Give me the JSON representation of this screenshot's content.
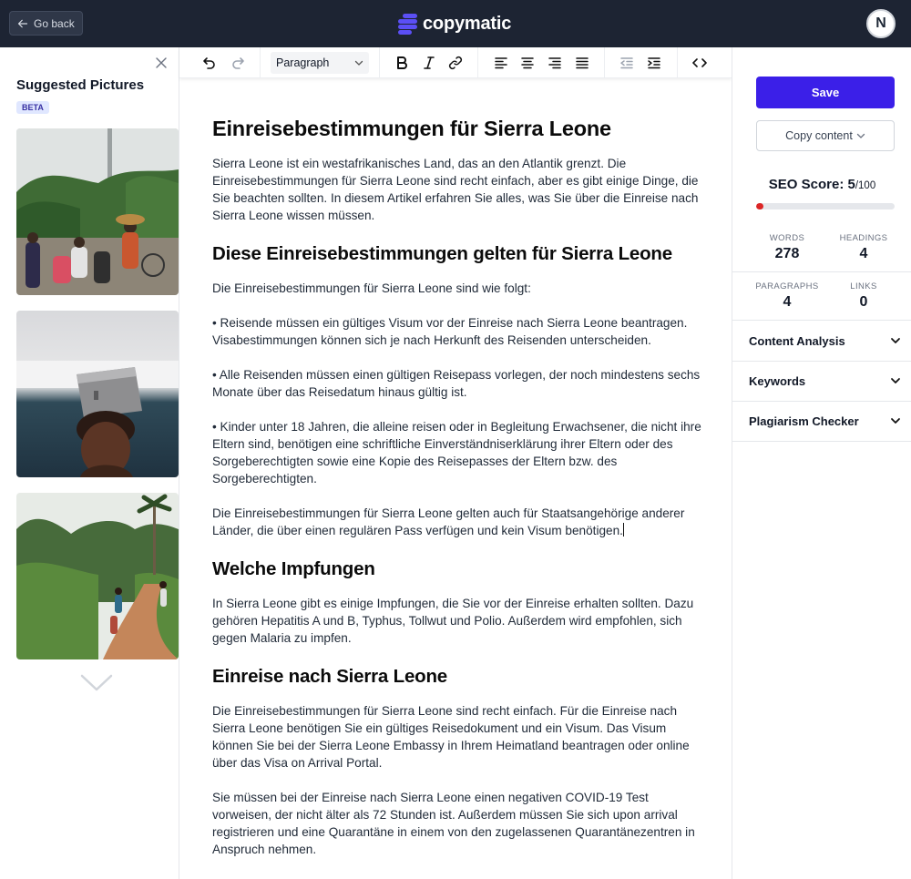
{
  "topbar": {
    "go_back_label": "Go back",
    "logo_text": "copymatic",
    "avatar_initial": "N"
  },
  "left_panel": {
    "title": "Suggested Pictures",
    "badge": "BETA",
    "pictures": [
      "street-market-photo",
      "box-on-head-photo",
      "dirt-road-photo"
    ]
  },
  "toolbar": {
    "block_format": "Paragraph",
    "icons": [
      "undo-icon",
      "redo-icon",
      "bold-icon",
      "italic-icon",
      "link-icon",
      "align-left-icon",
      "align-center-icon",
      "align-right-icon",
      "align-justify-icon",
      "outdent-icon",
      "indent-icon",
      "code-icon"
    ]
  },
  "document": {
    "h1": "Einreisebestimmungen für Sierra Leone",
    "p1": "Sierra Leone ist ein westafrikanisches Land, das an den Atlantik grenzt. Die Einreisebestimmungen für Sierra Leone sind recht einfach, aber es gibt einige Dinge, die Sie beachten sollten. In diesem Artikel erfahren Sie alles, was Sie über die Einreise nach Sierra Leone wissen müssen.",
    "h2_1": "Diese Einreisebestimmungen gelten für Sierra Leone",
    "p2": "Die Einreisebestimmungen für Sierra Leone sind wie folgt:",
    "p3": "• Reisende müssen ein gültiges Visum vor der Einreise nach Sierra Leone beantragen. Visabestimmungen können sich je nach Herkunft des Reisenden unterscheiden.",
    "p4": "• Alle Reisenden müssen einen gültigen Reisepass vorlegen, der noch mindestens sechs Monate über das Reisedatum hinaus gültig ist.",
    "p5": "• Kinder unter 18 Jahren, die alleine reisen oder in Begleitung Erwachsener, die nicht ihre Eltern sind, benötigen eine schriftliche Einverständniserklärung ihrer Eltern oder des Sorgeberechtigten sowie eine Kopie des Reisepasses der Eltern bzw. des Sorgeberechtigten.",
    "p6": "Die Einreisebestimmungen für Sierra Leone gelten auch für Staatsangehörige anderer Länder, die über einen regulären Pass verfügen und kein Visum benötigen.",
    "h2_2": "Welche Impfungen",
    "p7": "In Sierra Leone gibt es einige Impfungen, die Sie vor der Einreise erhalten sollten. Dazu gehören Hepatitis A und B, Typhus, Tollwut und Polio. Außerdem wird empfohlen, sich gegen Malaria zu impfen.",
    "h2_3": "Einreise nach Sierra Leone",
    "p8": "Die Einreisebestimmungen für Sierra Leone sind recht einfach. Für die Einreise nach Sierra Leone benötigen Sie ein gültiges Reisedokument und ein Visum. Das Visum können Sie bei der Sierra Leone Embassy in Ihrem Heimatland beantragen oder online über das Visa on Arrival Portal.",
    "p9": "Sie müssen bei der Einreise nach Sierra Leone einen negativen COVID-19 Test vorweisen, der nicht älter als 72 Stunden ist. Außerdem müssen Sie sich upon arrival registrieren und eine Quarantäne in einem von den zugelassenen Quarantänezentren in Anspruch nehmen."
  },
  "right_panel": {
    "save_label": "Save",
    "copy_label": "Copy content",
    "seo_label": "SEO Score:",
    "seo_score": "5",
    "seo_max": "/100",
    "seo_fraction": 0.05,
    "stats": {
      "words_label": "WORDS",
      "words": "278",
      "headings_label": "HEADINGS",
      "headings": "4",
      "paragraphs_label": "PARAGRAPHS",
      "paragraphs": "4",
      "links_label": "LINKS",
      "links": "0"
    },
    "accordions": [
      "Content Analysis",
      "Keywords",
      "Plagiarism Checker"
    ]
  },
  "colors": {
    "topbar": "#1d2433",
    "brand": "#5b4ff5",
    "save": "#3b1fe8",
    "seo_bar_fill": "#dc2626"
  }
}
